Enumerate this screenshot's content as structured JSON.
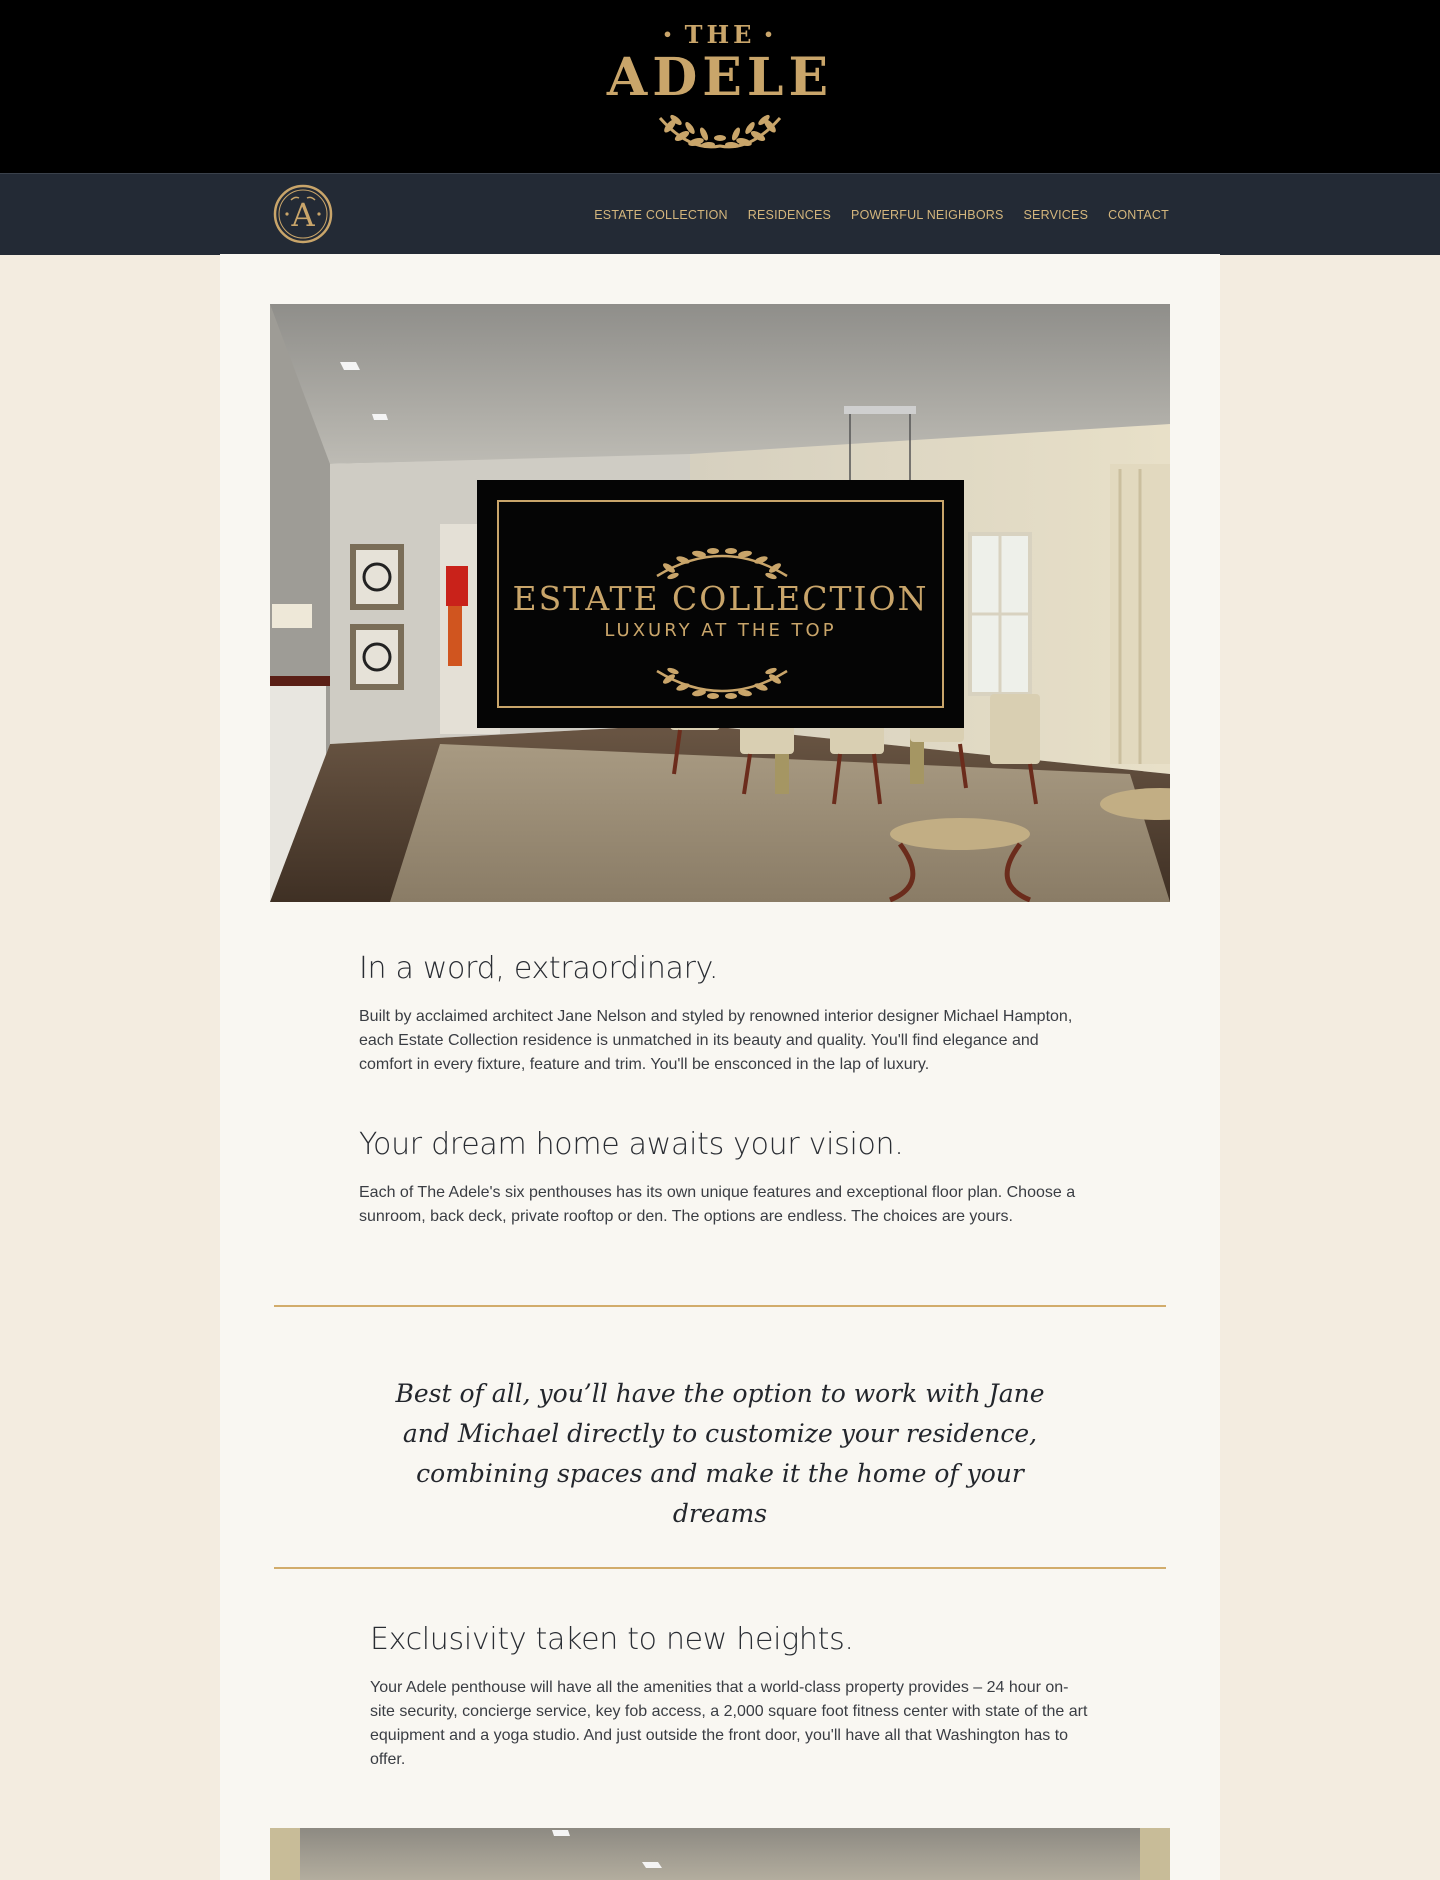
{
  "header": {
    "logo_the": "THE",
    "logo_name": "ADELE",
    "badge_letter": "A"
  },
  "nav": {
    "items": [
      {
        "label": "ESTATE COLLECTION"
      },
      {
        "label": "RESIDENCES"
      },
      {
        "label": "POWERFUL NEIGHBORS"
      },
      {
        "label": "SERVICES"
      },
      {
        "label": "CONTACT"
      }
    ]
  },
  "hero": {
    "card_title": "ESTATE COLLECTION",
    "card_subtitle": "LUXURY AT THE TOP"
  },
  "sections": [
    {
      "heading": "In a word, extraordinary.",
      "body": "Built by acclaimed architect Jane Nelson and styled by renowned interior designer Michael Hampton, each Estate Collection residence is unmatched in its beauty and quality. You'll find elegance and comfort in every fixture, feature and trim. You'll be ensconced in the lap of luxury."
    },
    {
      "heading": "Your dream home awaits your vision.",
      "body": "Each of The Adele's six penthouses has its own unique features and exceptional floor plan. Choose a sunroom, back deck, private rooftop or den. The options are endless. The choices are yours."
    },
    {
      "heading": "Exclusivity taken to new heights.",
      "body": "Your Adele penthouse will have all the amenities that a world-class property provides – 24 hour on-site security, concierge service, key fob access, a 2,000 square foot fitness center with state of the art equipment and a yoga studio. And just outside the front door, you'll have all that Washington has to offer."
    }
  ],
  "quote": "Best of all, you’ll have the option to work with Jane and Michael directly to customize your residence, combining spaces and make it the home of your dreams",
  "colors": {
    "gold": "#c9a56a",
    "navbar": "#232a35",
    "page_bg": "#f3ece0",
    "panel_bg": "#f9f7f2"
  }
}
